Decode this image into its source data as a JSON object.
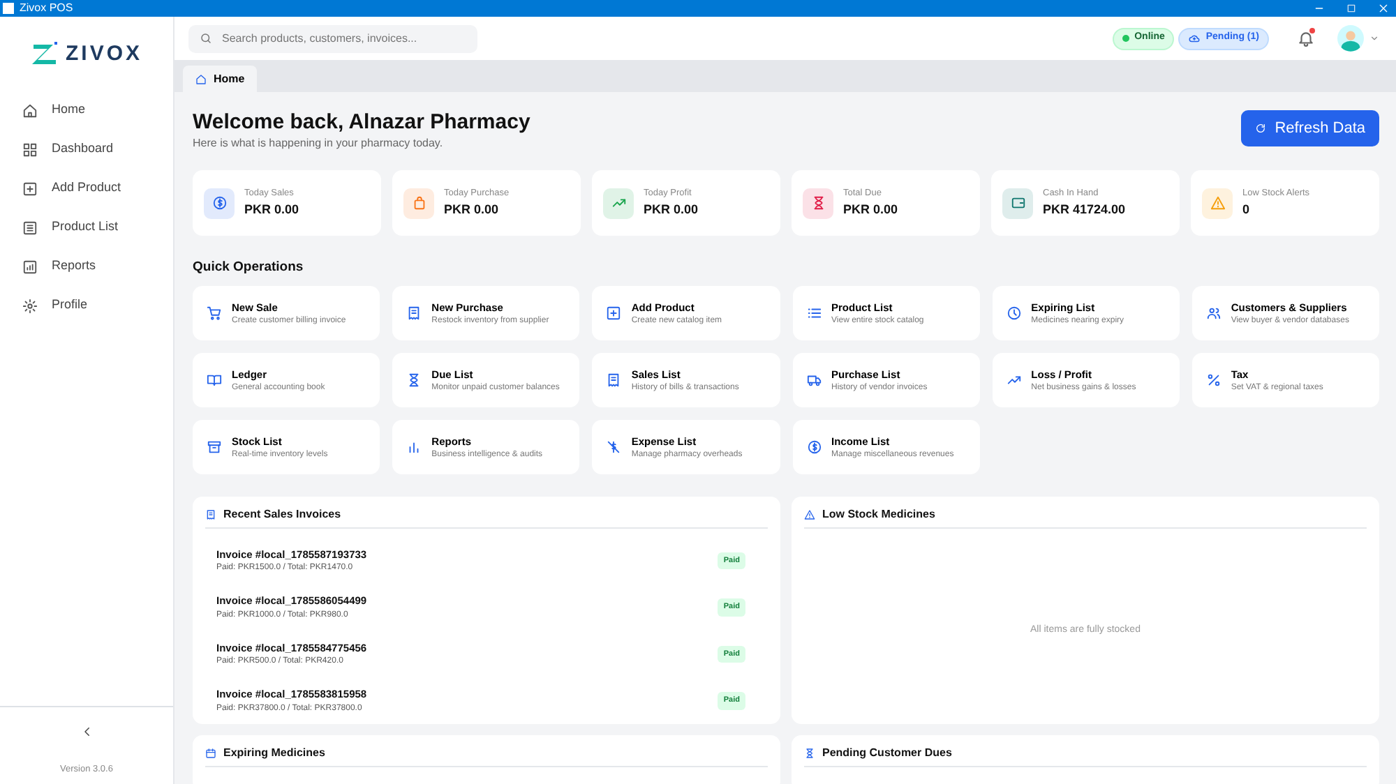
{
  "window": {
    "title": "Zivox POS"
  },
  "sidebar": {
    "logo": "ZIVOX",
    "items": [
      {
        "label": "Home",
        "selected": false
      },
      {
        "label": "Dashboard",
        "selected": false
      },
      {
        "label": "Add Product",
        "selected": false
      },
      {
        "label": "Product List",
        "selected": false
      },
      {
        "label": "Reports",
        "selected": false
      },
      {
        "label": "Profile",
        "selected": false
      }
    ],
    "version": "Version 3.0.6"
  },
  "topbar": {
    "search": {
      "placeholder": "Search products, customers, invoices..."
    },
    "online": {
      "label": "Online"
    },
    "pending": {
      "label": "Pending (1)"
    },
    "notifications": {
      "unread": true
    }
  },
  "tabs": [
    {
      "label": "Home",
      "selected": true
    }
  ],
  "header": {
    "title": "Welcome back, Alnazar Pharmacy",
    "subtitle": "Here is what is happening in your pharmacy today.",
    "refresh_button": "Refresh Data"
  },
  "stats": [
    {
      "label": "Today Sales",
      "value": "PKR 0.00",
      "color": "#2563eb"
    },
    {
      "label": "Today Purchase",
      "value": "PKR 0.00",
      "color": "#f97316"
    },
    {
      "label": "Today Profit",
      "value": "PKR 0.00",
      "color": "#16a34a"
    },
    {
      "label": "Total Due",
      "value": "PKR 0.00",
      "color": "#e11d48"
    },
    {
      "label": "Cash In Hand",
      "value": "PKR 41724.00",
      "color": "#0f766e"
    },
    {
      "label": "Low Stock Alerts",
      "value": "0",
      "color": "#f59e0b"
    }
  ],
  "quick_operations": {
    "title": "Quick Operations",
    "items": [
      {
        "title": "New Sale",
        "subtitle": "Create customer billing invoice"
      },
      {
        "title": "New Purchase",
        "subtitle": "Restock inventory from supplier"
      },
      {
        "title": "Add Product",
        "subtitle": "Create new catalog item"
      },
      {
        "title": "Product List",
        "subtitle": "View entire stock catalog"
      },
      {
        "title": "Expiring List",
        "subtitle": "Medicines nearing expiry"
      },
      {
        "title": "Customers & Suppliers",
        "subtitle": "View buyer & vendor databases"
      },
      {
        "title": "Ledger",
        "subtitle": "General accounting book"
      },
      {
        "title": "Due List",
        "subtitle": "Monitor unpaid customer balances"
      },
      {
        "title": "Sales List",
        "subtitle": "History of bills & transactions"
      },
      {
        "title": "Purchase List",
        "subtitle": "History of vendor invoices"
      },
      {
        "title": "Loss / Profit",
        "subtitle": "Net business gains & losses"
      },
      {
        "title": "Tax",
        "subtitle": "Set VAT & regional taxes"
      },
      {
        "title": "Stock List",
        "subtitle": "Real-time inventory levels"
      },
      {
        "title": "Reports",
        "subtitle": "Business intelligence & audits"
      },
      {
        "title": "Expense List",
        "subtitle": "Manage pharmacy overheads"
      },
      {
        "title": "Income List",
        "subtitle": "Manage miscellaneous revenues"
      }
    ]
  },
  "recent_sales": {
    "title": "Recent Sales Invoices",
    "invoices": [
      {
        "number": "Invoice #local_1785587193733",
        "detail": "Paid: PKR1500.0 / Total: PKR1470.0",
        "status": "Paid"
      },
      {
        "number": "Invoice #local_1785586054499",
        "detail": "Paid: PKR1000.0 / Total: PKR980.0",
        "status": "Paid"
      },
      {
        "number": "Invoice #local_1785584775456",
        "detail": "Paid: PKR500.0 / Total: PKR420.0",
        "status": "Paid"
      },
      {
        "number": "Invoice #local_1785583815958",
        "detail": "Paid: PKR37800.0 / Total: PKR37800.0",
        "status": "Paid"
      }
    ]
  },
  "low_stock": {
    "title": "Low Stock Medicines",
    "empty_message": "All items are fully stocked"
  },
  "expiring": {
    "title": "Expiring Medicines"
  },
  "pending_dues": {
    "title": "Pending Customer Dues"
  }
}
